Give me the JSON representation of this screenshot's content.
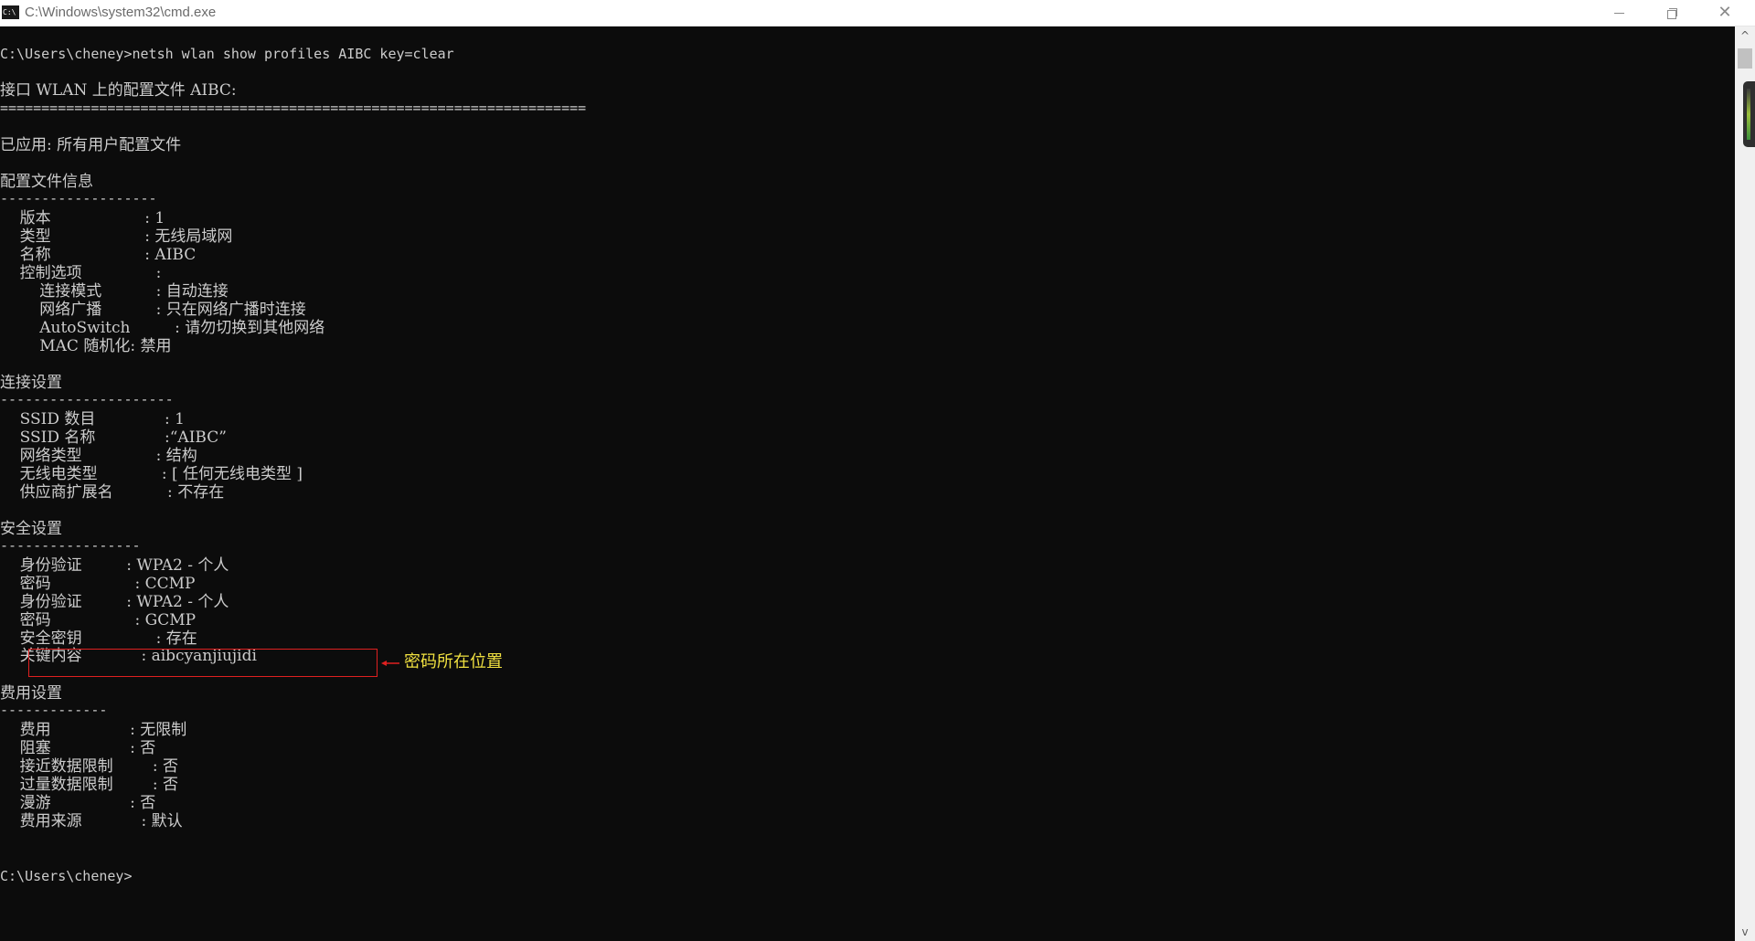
{
  "window": {
    "title": "C:\\Windows\\system32\\cmd.exe",
    "icon_text": "C:\\",
    "controls": {
      "minimize": "minimize-icon",
      "maximize": "restore-icon",
      "close": "close-icon",
      "close_glyph": "✕"
    }
  },
  "console": {
    "lines": [
      "C:\\Users\\cheney>netsh wlan show profiles AIBC key=clear",
      "接口 WLAN 上的配置文件 AIBC:",
      "=======================================================================",
      "已应用: 所有用户配置文件",
      "配置文件信息",
      "-------------------",
      "    版本                   : 1",
      "    类型                   : 无线局域网",
      "    名称                   : AIBC",
      "    控制选项               :",
      "        连接模式           : 自动连接",
      "        网络广播           : 只在网络广播时连接",
      "        AutoSwitch         : 请勿切换到其他网络",
      "        MAC 随机化: 禁用",
      "连接设置",
      "---------------------",
      "    SSID 数目              : 1",
      "    SSID 名称              :“AIBC”",
      "    网络类型               : 结构",
      "    无线电类型             : [ 任何无线电类型 ]",
      "    供应商扩展名           : 不存在",
      "安全设置",
      "-----------------",
      "    身份验证         : WPA2 - 个人",
      "    密码                 : CCMP",
      "    身份验证         : WPA2 - 个人",
      "    密码                 : GCMP",
      "    安全密钥               : 存在",
      "    关键内容            : aibcyanjiujidi",
      "费用设置",
      "-------------",
      "    费用                : 无限制",
      "    阻塞                : 否",
      "    接近数据限制        : 否",
      "    过量数据限制        : 否",
      "    漫游                : 否",
      "    费用来源            : 默认",
      "C:\\Users\\cheney>"
    ]
  },
  "annotation": {
    "label": "密码所在位置",
    "color": "#f0e040",
    "box_color": "#e02020"
  },
  "scrollbar": {
    "up_glyph": "^",
    "down_glyph": "v"
  },
  "colors": {
    "background": "#0c0c0c",
    "text": "#cccccc"
  }
}
